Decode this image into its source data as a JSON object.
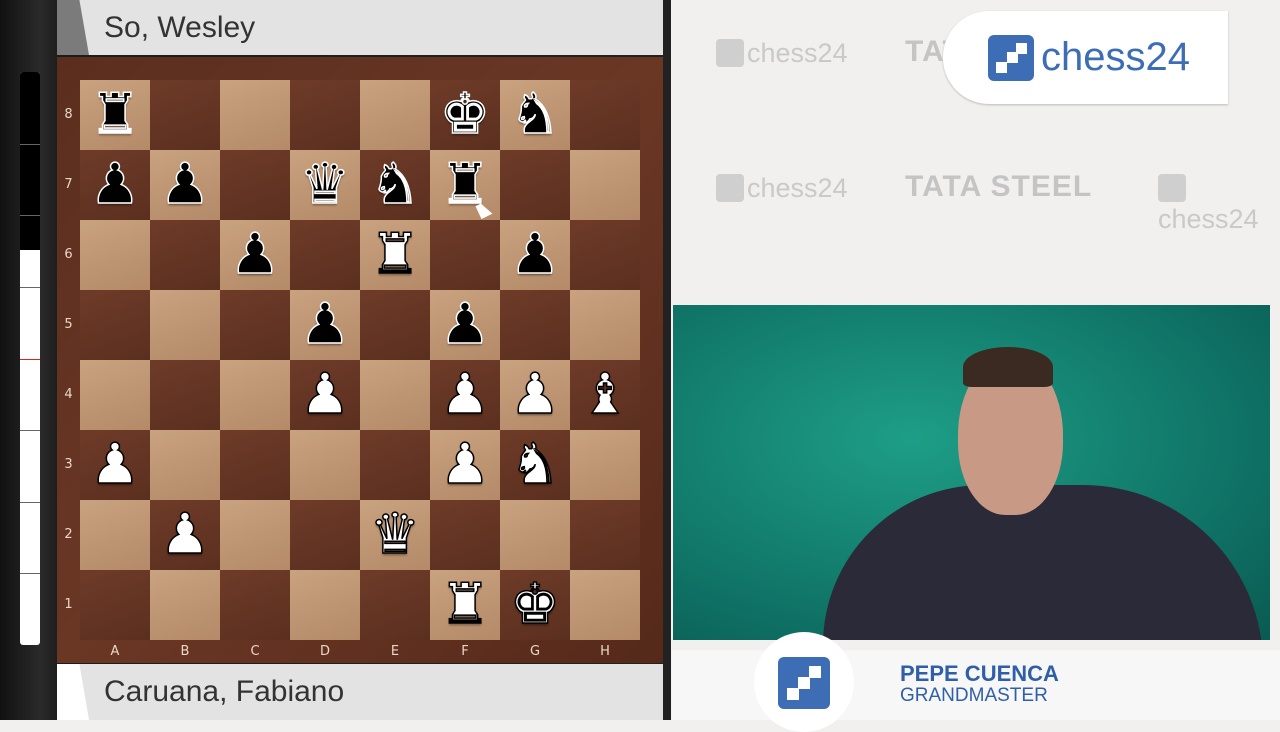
{
  "players": {
    "top": "So, Wesley",
    "bottom": "Caruana, Fabiano"
  },
  "evaluation": {
    "white_fraction": 0.69
  },
  "board": {
    "ranks": [
      "8",
      "7",
      "6",
      "5",
      "4",
      "3",
      "2",
      "1"
    ],
    "files": [
      "A",
      "B",
      "C",
      "D",
      "E",
      "F",
      "G",
      "H"
    ],
    "position": [
      "r....kn.",
      "pp.qnr..",
      "..p.R.p.",
      "...p.p..",
      "...P.PPB",
      "P....PN.",
      ".P..Q...",
      ".....RK."
    ]
  },
  "branding": {
    "logo": "chess24",
    "watermark_logo": "chess24",
    "sponsor": "TATA STEEL",
    "brand_color": "#3d6db5"
  },
  "commentator": {
    "name": "PEPE CUENCA",
    "title": "GRANDMASTER"
  }
}
